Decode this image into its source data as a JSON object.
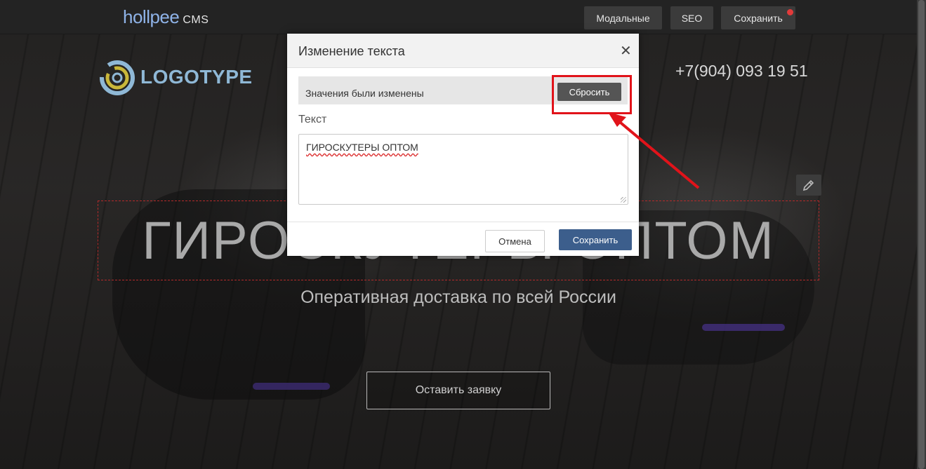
{
  "cms_bar": {
    "logo": "hollpee",
    "logo_suffix": "CMS",
    "buttons": {
      "modals": "Модальные",
      "seo": "SEO",
      "save": "Сохранить"
    },
    "notification_color": "#e23a3a"
  },
  "site": {
    "logo_text": "LOGOTYPE",
    "phone": "+7(904) 093 19 51",
    "hero_title": "ГИРОСКУТЕРЫ ОПТОМ",
    "hero_subtitle": "Оперативная доставка по всей России",
    "cta": "Оставить заявку"
  },
  "modal": {
    "title": "Изменение текста",
    "close_icon": "close-icon",
    "changed_notice": "Значения были изменены",
    "reset_button": "Сбросить",
    "field_label": "Текст",
    "field_value": "ГИРОСКУТЕРЫ ОПТОМ",
    "cancel_button": "Отмена",
    "save_button": "Сохранить",
    "save_color": "#3c5e8c"
  },
  "annotation": {
    "highlight_color": "#e1131a"
  }
}
